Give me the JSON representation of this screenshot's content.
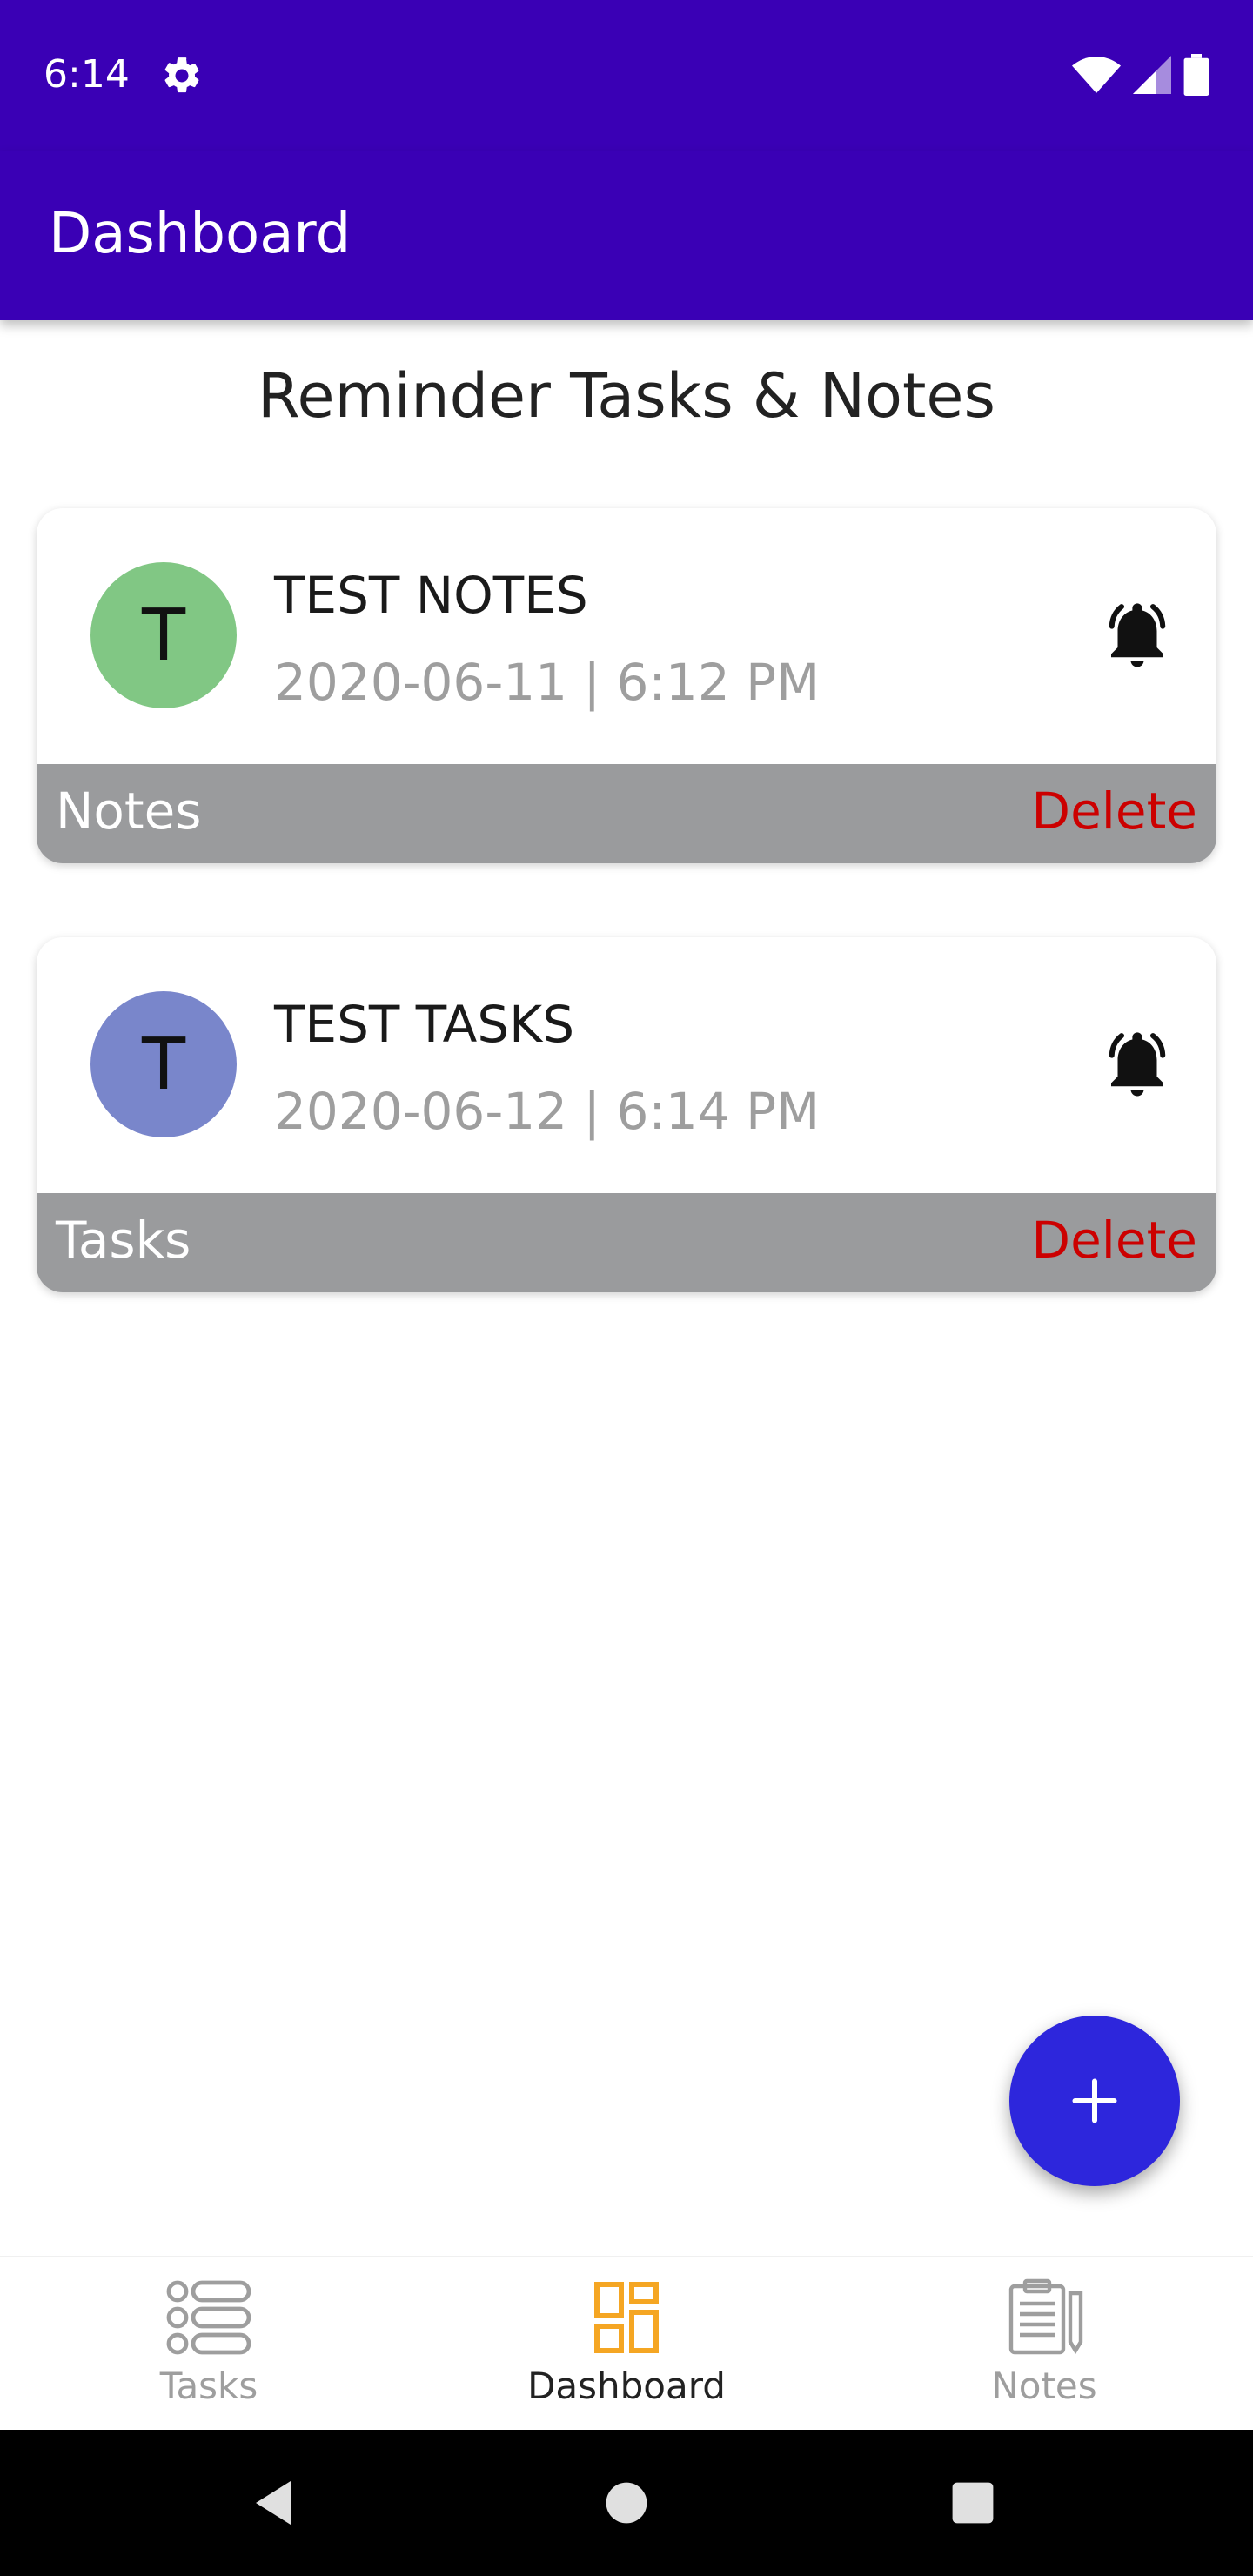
{
  "status_bar": {
    "time": "6:14",
    "icons": [
      "settings-icon",
      "wifi-icon",
      "signal-icon",
      "battery-icon"
    ]
  },
  "app_bar": {
    "title": "Dashboard"
  },
  "section": {
    "title": "Reminder Tasks & Notes"
  },
  "cards": [
    {
      "initial": "T",
      "title": "TEST NOTES",
      "date": "2020-06-11 | 6:12 PM",
      "type": "Notes",
      "delete_label": "Delete",
      "avatar_color": "#81c784",
      "icon": "bell-ring-icon"
    },
    {
      "initial": "T",
      "title": "TEST TASKS",
      "date": "2020-06-12 | 6:14 PM",
      "type": "Tasks",
      "delete_label": "Delete",
      "avatar_color": "#7986cb",
      "icon": "bell-ring-icon"
    }
  ],
  "fab": {
    "icon": "plus-icon"
  },
  "bottom_nav": {
    "items": [
      {
        "label": "Tasks",
        "icon": "list-icon",
        "active": false
      },
      {
        "label": "Dashboard",
        "icon": "dashboard-icon",
        "active": true
      },
      {
        "label": "Notes",
        "icon": "notes-icon",
        "active": false
      }
    ]
  },
  "colors": {
    "primary": "#3a00b5",
    "fab": "#2d26dc",
    "delete": "#cc0000",
    "footer": "#9a9b9d",
    "nav_active_icon": "#f5a623",
    "nav_inactive": "#9e9e9e"
  }
}
